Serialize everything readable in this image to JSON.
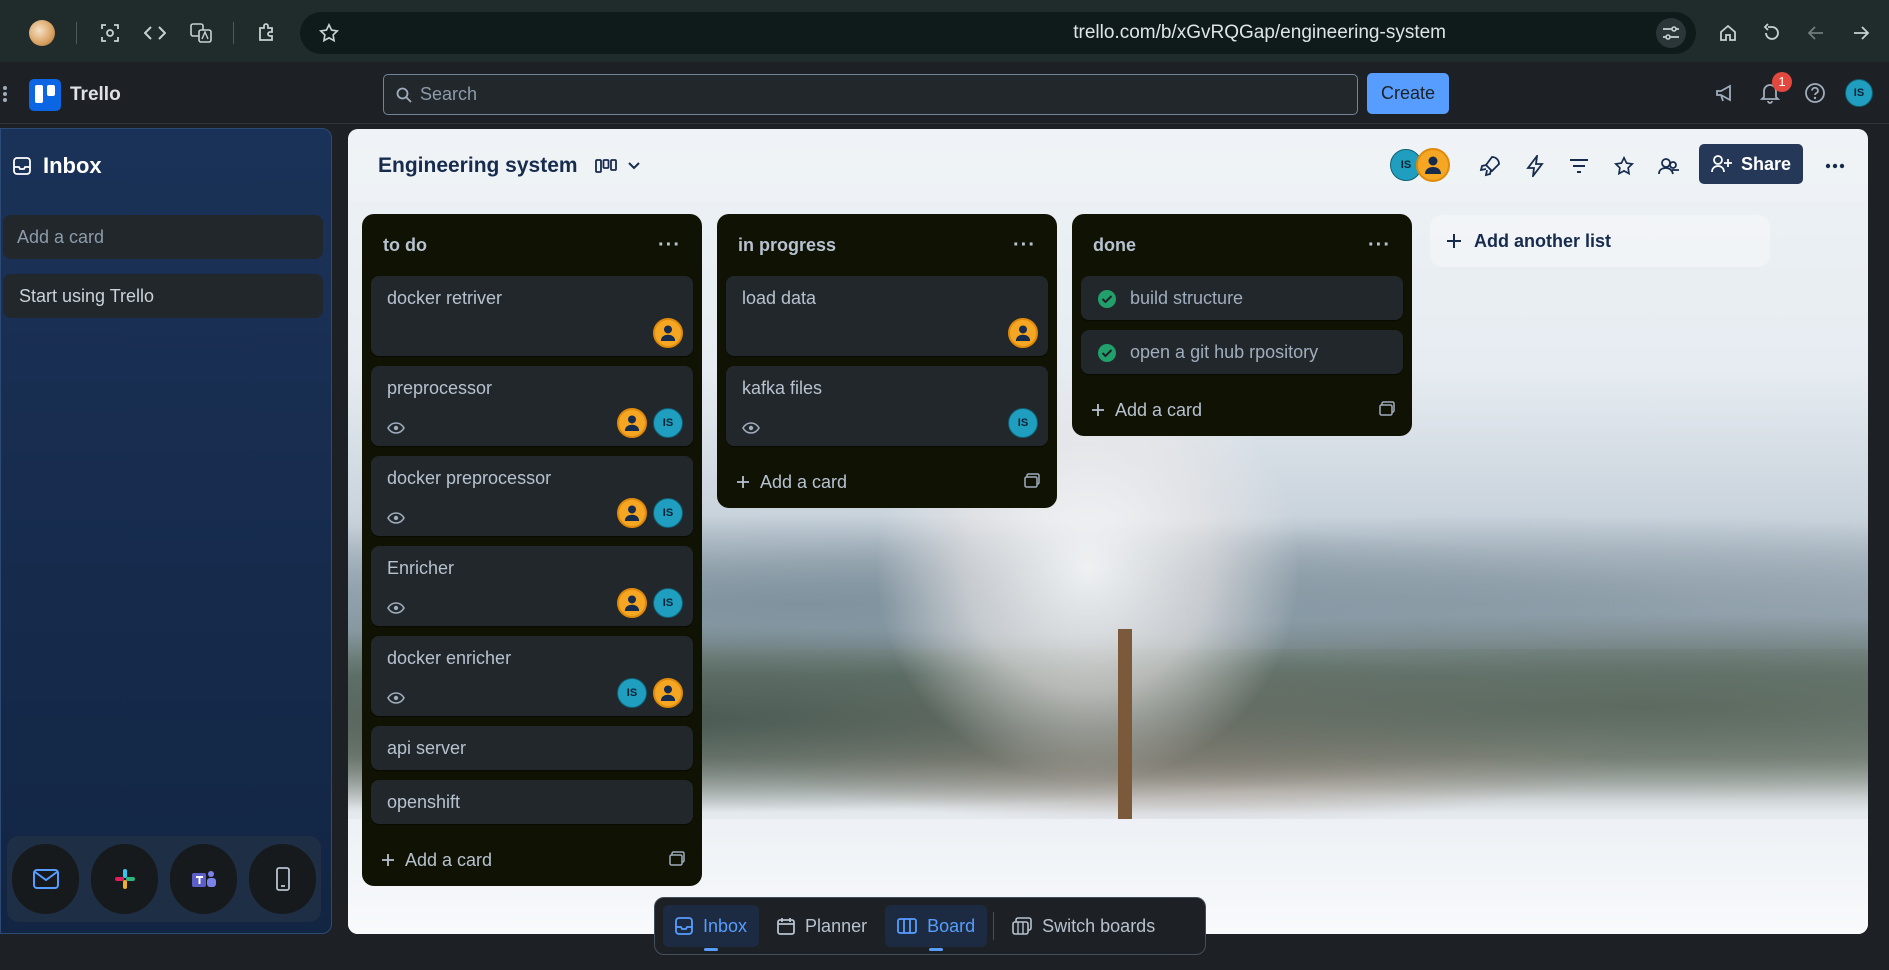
{
  "browser": {
    "url": "trello.com/b/xGvRQGap/engineering-system"
  },
  "app": {
    "name": "Trello",
    "search_placeholder": "Search",
    "create_label": "Create",
    "notification_count": "1",
    "user_initials": "IS"
  },
  "sidebar": {
    "title": "Inbox",
    "add_card_placeholder": "Add a card",
    "cards": [
      "Start using Trello"
    ]
  },
  "board": {
    "title": "Engineering system",
    "member_initials": "IS",
    "share_label": "Share",
    "add_list_label": "Add another list",
    "lists": [
      {
        "title": "to do",
        "add_label": "Add a card",
        "cards": [
          {
            "title": "docker retriver"
          },
          {
            "title": "preprocessor"
          },
          {
            "title": "docker preprocessor"
          },
          {
            "title": "Enricher"
          },
          {
            "title": "docker enricher"
          },
          {
            "title": "api server"
          },
          {
            "title": "openshift"
          }
        ]
      },
      {
        "title": "in progress",
        "add_label": "Add a card",
        "cards": [
          {
            "title": "load data"
          },
          {
            "title": "kafka files"
          }
        ]
      },
      {
        "title": "done",
        "add_label": "Add a card",
        "cards": [
          {
            "title": "build structure"
          },
          {
            "title": "open a git hub rpository"
          }
        ]
      }
    ]
  },
  "bottom_nav": {
    "inbox": "Inbox",
    "planner": "Planner",
    "board": "Board",
    "switch": "Switch boards"
  },
  "colors": {
    "accent": "#579dff",
    "share_bg": "#253858",
    "list_bg": "#101204",
    "done_green": "#22a06b"
  }
}
